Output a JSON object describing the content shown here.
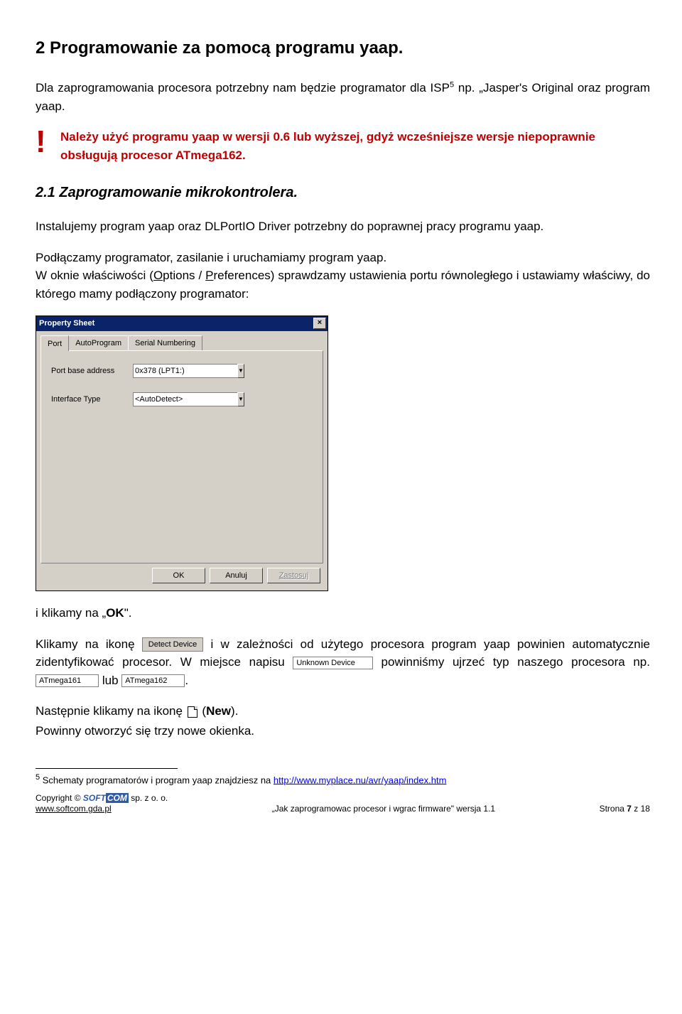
{
  "h1": "2 Programowanie za pomocą programu yaap.",
  "intro_before_sup": "Dla zaprogramowania procesora potrzebny nam będzie programator dla ISP",
  "intro_sup": "5",
  "intro_after_sup": " np. „Jasper's Original oraz program yaap.",
  "note_excl": "!",
  "note_text": "Należy użyć programu yaap w wersji 0.6 lub wyższej, gdyż wcześniejsze wersje niepoprawnie obsługują procesor ATmega162.",
  "h2": "2.1 Zaprogramowanie mikrokontrolera.",
  "p2": "Instalujemy program yaap oraz DLPortIO Driver potrzebny do poprawnej pracy programu yaap.",
  "p3": "Podłączamy programator, zasilanie i uruchamiamy program yaap.",
  "p4_pre": "W oknie właściwości (",
  "p4_o": "O",
  "p4_mid1": "ptions / ",
  "p4_p": "P",
  "p4_mid2": "references) sprawdzamy ustawienia portu równoległego i ustawiamy właściwy, do którego mamy podłączony programator:",
  "win": {
    "title": "Property Sheet",
    "tabs": [
      "Port",
      "AutoProgram",
      "Serial Numbering"
    ],
    "label_port": "Port base address",
    "val_port": "0x378 (LPT1:)",
    "label_iface": "Interface Type",
    "val_iface": "<AutoDetect>",
    "btn_ok": "OK",
    "btn_cancel": "Anuluj",
    "btn_apply": "Zastosuj"
  },
  "p5_pre": "i klikamy na „",
  "p5_ok": "OK",
  "p5_post": "\".",
  "p6_a": "Klikamy na ikonę ",
  "chip_detect": "Detect Device",
  "p6_b": " i w zależności od użytego procesora program yaap powinien automatycznie zidentyfikować procesor. W miejsce napisu ",
  "chip_unknown": "Unknown Device",
  "p6_c": " powinniśmy ujrzeć typ naszego procesora np. ",
  "chip_161": "ATmega161",
  "p6_lub": " lub ",
  "chip_162": "ATmega162",
  "p6_dot": ".",
  "p7_a": "Następnie klikamy na ikonę ",
  "p7_b": " (",
  "p7_new": "New",
  "p7_c": ").",
  "p8": "Powinny otworzyć się trzy nowe okienka.",
  "fn_sup": "5",
  "fn_text": " Schematy programatorów i program yaap znajdziesz na ",
  "fn_url": "http://www.myplace.nu/avr/yaap/index.htm",
  "footer": {
    "copyright": "Copyright © ",
    "soft": "SOFT",
    "com": "COM",
    "sp": " sp. z o. o.",
    "www": "www.softcom.gda.pl",
    "center": "„Jak zaprogramowac procesor i wgrac firmware\" wersja 1.1",
    "right_a": "Strona ",
    "right_b": "7",
    "right_c": " z 18"
  }
}
